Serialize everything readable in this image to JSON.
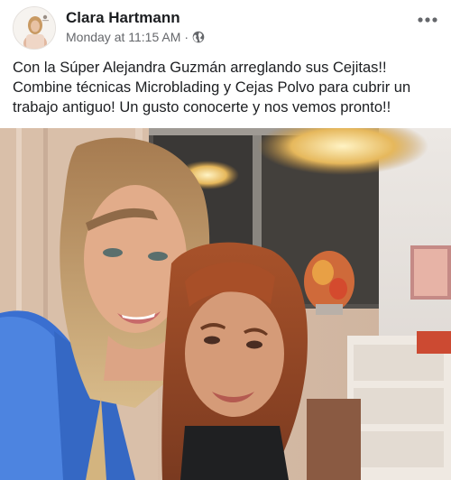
{
  "post": {
    "author": "Clara Hartmann",
    "timestamp": "Monday at 11:15 AM",
    "separator": "·",
    "privacy_icon": "globe-icon",
    "more_icon": "more-options-icon",
    "caption_lines": [
      "Con la Súper Alejandra Guzmán arreglando sus Cejitas!!",
      "Combine técnicas Microblading y Cejas Polvo para cubrir un",
      "trabajo antiguo! Un gusto conocerte y nos vemos pronto!!"
    ]
  },
  "colors": {
    "name": "#1c1e21",
    "meta": "#65676b",
    "scrub_blue": "#3a6fd0"
  }
}
